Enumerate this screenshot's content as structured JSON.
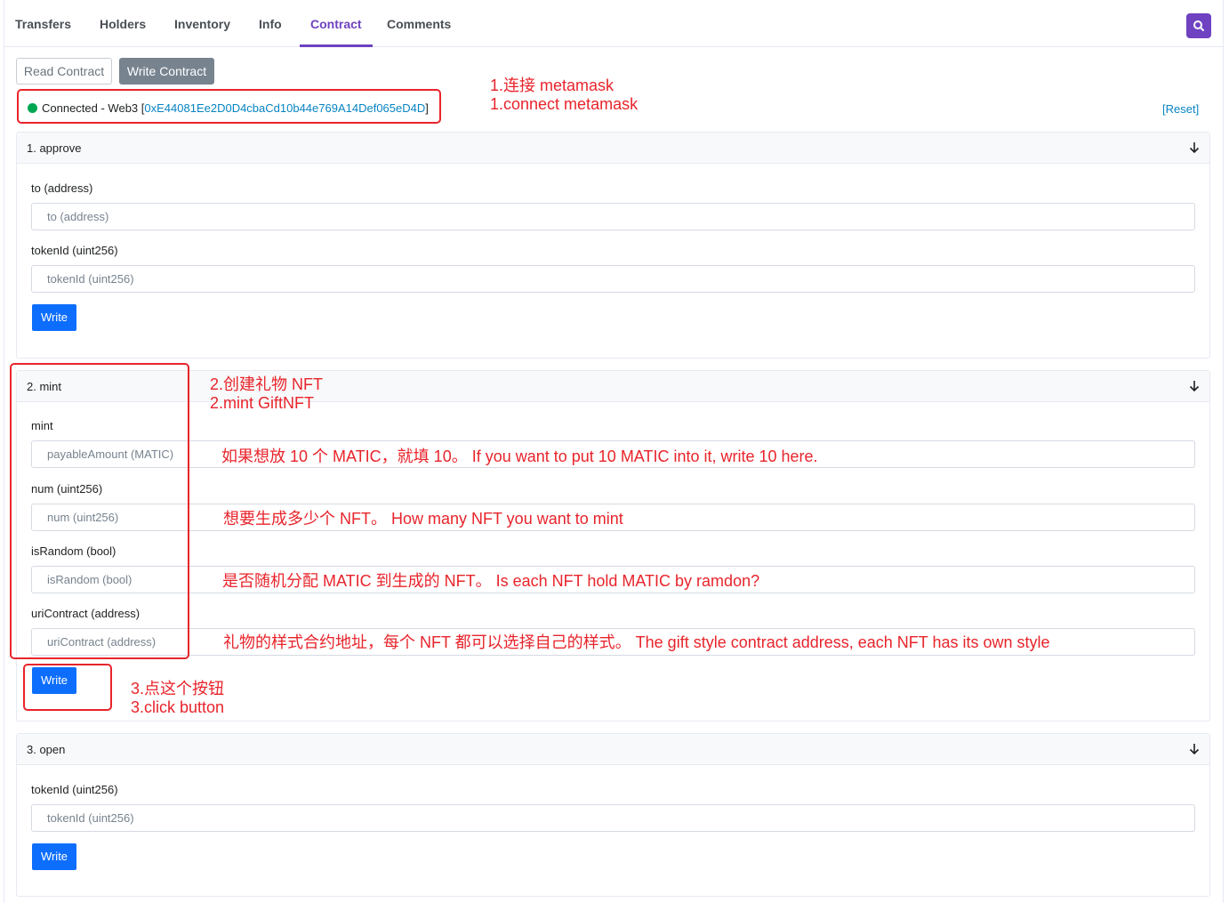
{
  "tabs": [
    {
      "label": "Transfers"
    },
    {
      "label": "Holders"
    },
    {
      "label": "Inventory"
    },
    {
      "label": "Info"
    },
    {
      "label": "Contract",
      "active": true
    },
    {
      "label": "Comments"
    }
  ],
  "contract_buttons": {
    "read": "Read Contract",
    "write": "Write Contract"
  },
  "connection": {
    "status_prefix": "Connected - Web3 [",
    "address": "0xE44081Ee2D0D4cbaCd10b44e769A14Def065eD4D",
    "status_suffix": "]",
    "reset": "[Reset]",
    "dot_color": "#00a651"
  },
  "approve": {
    "title": "1. approve",
    "to_label": "to (address)",
    "to_placeholder": "to (address)",
    "token_label": "tokenId (uint256)",
    "token_placeholder": "tokenId (uint256)",
    "write": "Write"
  },
  "mint": {
    "title": "2. mint",
    "payable_label": "mint",
    "payable_placeholder": "payableAmount (MATIC)",
    "num_label": "num (uint256)",
    "num_placeholder": "num (uint256)",
    "random_label": "isRandom (bool)",
    "random_placeholder": "isRandom (bool)",
    "uri_label": "uriContract (address)",
    "uri_placeholder": "uriContract (address)",
    "write": "Write"
  },
  "open": {
    "title": "3. open",
    "token_label": "tokenId (uint256)",
    "token_placeholder": "tokenId (uint256)",
    "write": "Write"
  },
  "annotations": {
    "step1_zh": "1.连接 metamask",
    "step1_en": "1.connect metamask",
    "step2_zh": "2.创建礼物 NFT",
    "step2_en": "2.mint GiftNFT",
    "payable_hint": "如果想放 10 个 MATIC，就填 10。   If you want to put 10 MATIC into it, write 10 here.",
    "num_hint": "想要生成多少个 NFT。  How many NFT you want to mint",
    "random_hint": "是否随机分配 MATIC 到生成的 NFT。  Is each NFT hold MATIC by ramdon?",
    "uri_hint": "礼物的样式合约地址，每个 NFT 都可以选择自己的样式。  The gift style contract address, each NFT has its own style",
    "step3_zh": "3.点这个按钮",
    "step3_en": "3.click button",
    "color": "#e8242b"
  },
  "icons": {
    "search": "search-icon",
    "collapse": "arrow-down-icon"
  }
}
